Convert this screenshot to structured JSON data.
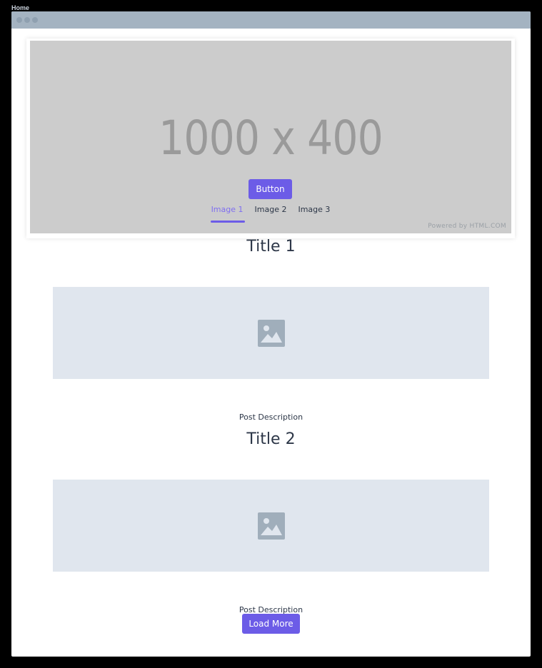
{
  "page": {
    "label": "Home"
  },
  "hero": {
    "placeholder_text": "1000 x 400",
    "button_label": "Button",
    "tabs": [
      {
        "label": "Image 1",
        "active": true
      },
      {
        "label": "Image 2",
        "active": false
      },
      {
        "label": "Image 3",
        "active": false
      }
    ],
    "powered_by": "Powered by HTML.COM"
  },
  "posts": [
    {
      "title": "Title 1",
      "description": "Post Description",
      "image_icon": "image-icon"
    },
    {
      "title": "Title 2",
      "description": "Post Description",
      "image_icon": "image-icon"
    }
  ],
  "load_more_label": "Load More",
  "colors": {
    "accent": "#6c5ce7",
    "titlebar": "#a4b3c1",
    "placeholder_bg": "#e0e6ee",
    "hero_bg": "#cccccc",
    "text": "#2d3748"
  }
}
